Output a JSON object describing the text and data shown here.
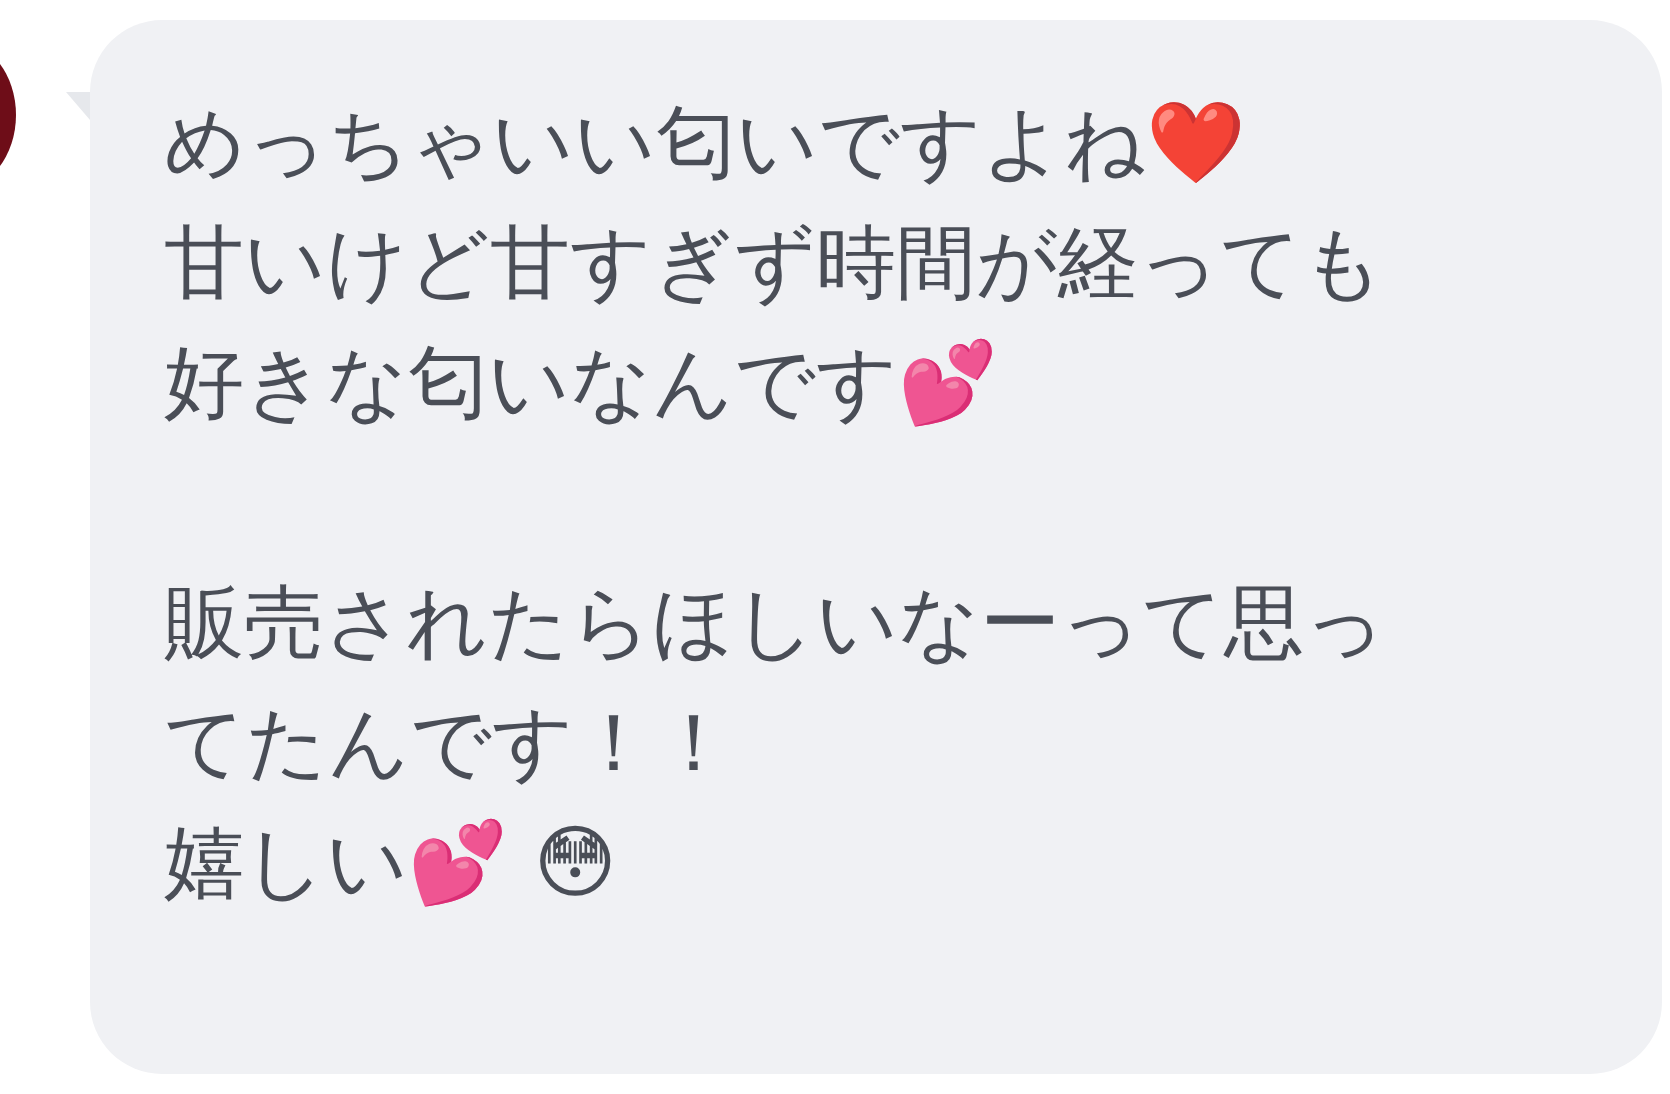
{
  "message": {
    "paragraphs": [
      {
        "lines": [
          "めっちゃいい匂いですよね❤️",
          "甘いけど甘すぎず時間が経っても",
          "好きな匂いなんです💕"
        ]
      },
      {
        "lines": [
          "販売されたらほしいなーって思っ",
          "てたんです！！",
          "嬉しい💕 😳"
        ]
      }
    ]
  }
}
